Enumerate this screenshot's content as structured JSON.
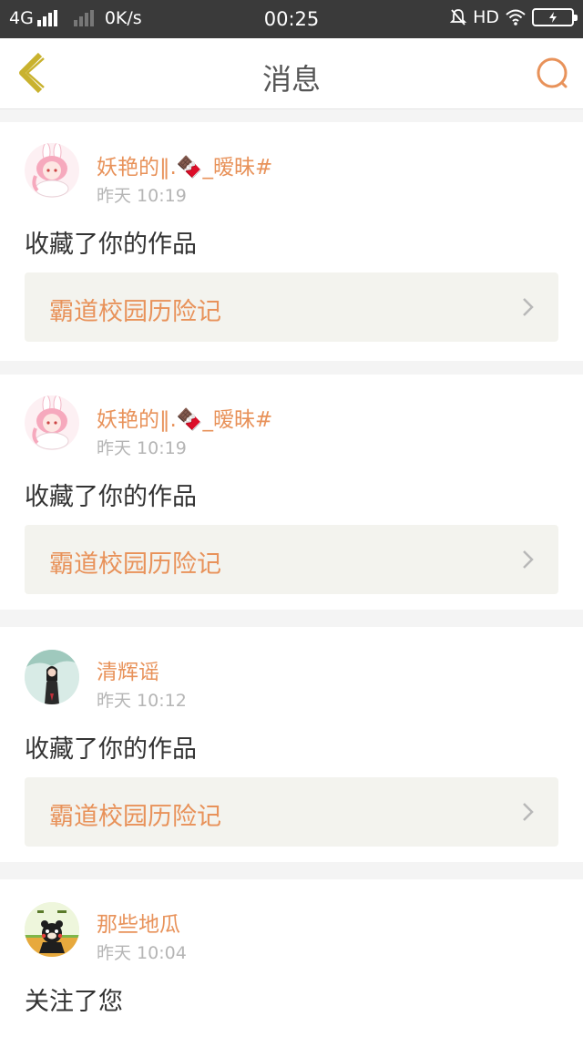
{
  "status_bar": {
    "network": "4G",
    "speed": "0K/s",
    "time": "00:25",
    "hd": "HD"
  },
  "header": {
    "title": "消息",
    "back_icon": "chevron-left-icon",
    "search_icon": "search-icon"
  },
  "messages": [
    {
      "user": "妖艳的‖.🍫_暧昧#",
      "time": "昨天 10:19",
      "action": "收藏了你的作品",
      "work": "霸道校园历险记"
    },
    {
      "user": "妖艳的‖.🍫_暧昧#",
      "time": "昨天 10:19",
      "action": "收藏了你的作品",
      "work": "霸道校园历险记"
    },
    {
      "user": "清辉谣",
      "time": "昨天 10:12",
      "action": "收藏了你的作品",
      "work": "霸道校园历险记"
    },
    {
      "user": "那些地瓜",
      "time": "昨天 10:04",
      "action": "关注了您"
    }
  ],
  "colors": {
    "accent": "#e8925a",
    "back_icon": "#c9b22e",
    "status_bar": "#3a3a3a"
  }
}
